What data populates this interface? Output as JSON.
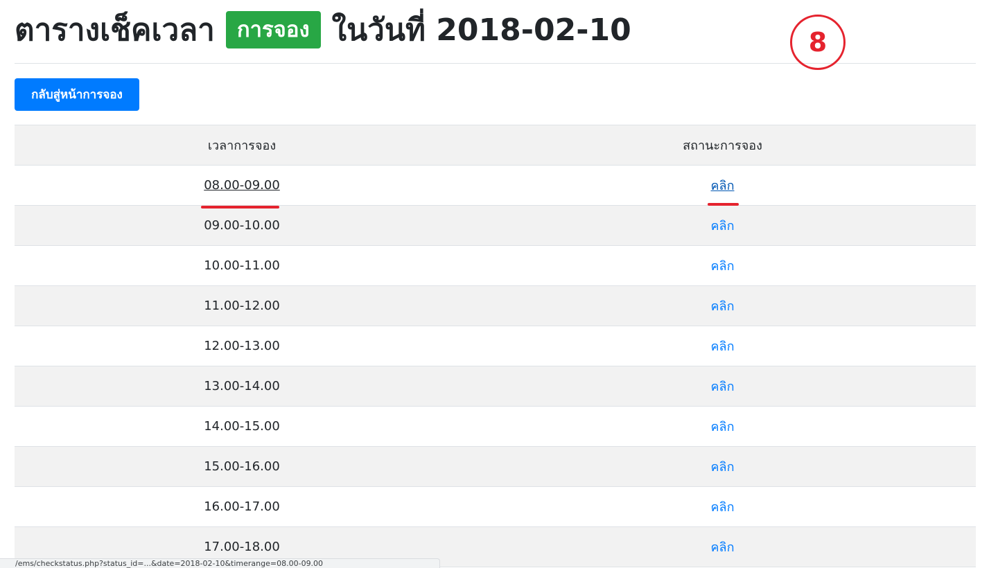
{
  "title": {
    "prefix": "ตารางเช็คเวลา",
    "badge": "การจอง",
    "suffix": "ในวันที่ 2018-02-10"
  },
  "step_marker": "8",
  "back_button": "กลับสู่หน้าการจอง",
  "table": {
    "headers": [
      "เวลาการจอง",
      "สถานะการจอง"
    ],
    "rows": [
      {
        "time": "08.00-09.00",
        "status": "คลิก"
      },
      {
        "time": "09.00-10.00",
        "status": "คลิก"
      },
      {
        "time": "10.00-11.00",
        "status": "คลิก"
      },
      {
        "time": "11.00-12.00",
        "status": "คลิก"
      },
      {
        "time": "12.00-13.00",
        "status": "คลิก"
      },
      {
        "time": "13.00-14.00",
        "status": "คลิก"
      },
      {
        "time": "14.00-15.00",
        "status": "คลิก"
      },
      {
        "time": "15.00-16.00",
        "status": "คลิก"
      },
      {
        "time": "16.00-17.00",
        "status": "คลิก"
      },
      {
        "time": "17.00-18.00",
        "status": "คลิก"
      }
    ]
  },
  "status_bar_url": "/ems/checkstatus.php?status_id=...&date=2018-02-10&timerange=08.00-09.00",
  "colors": {
    "badge": "#28a745",
    "button": "#007bff",
    "link": "#007bff",
    "annotation": "#e5232e"
  }
}
